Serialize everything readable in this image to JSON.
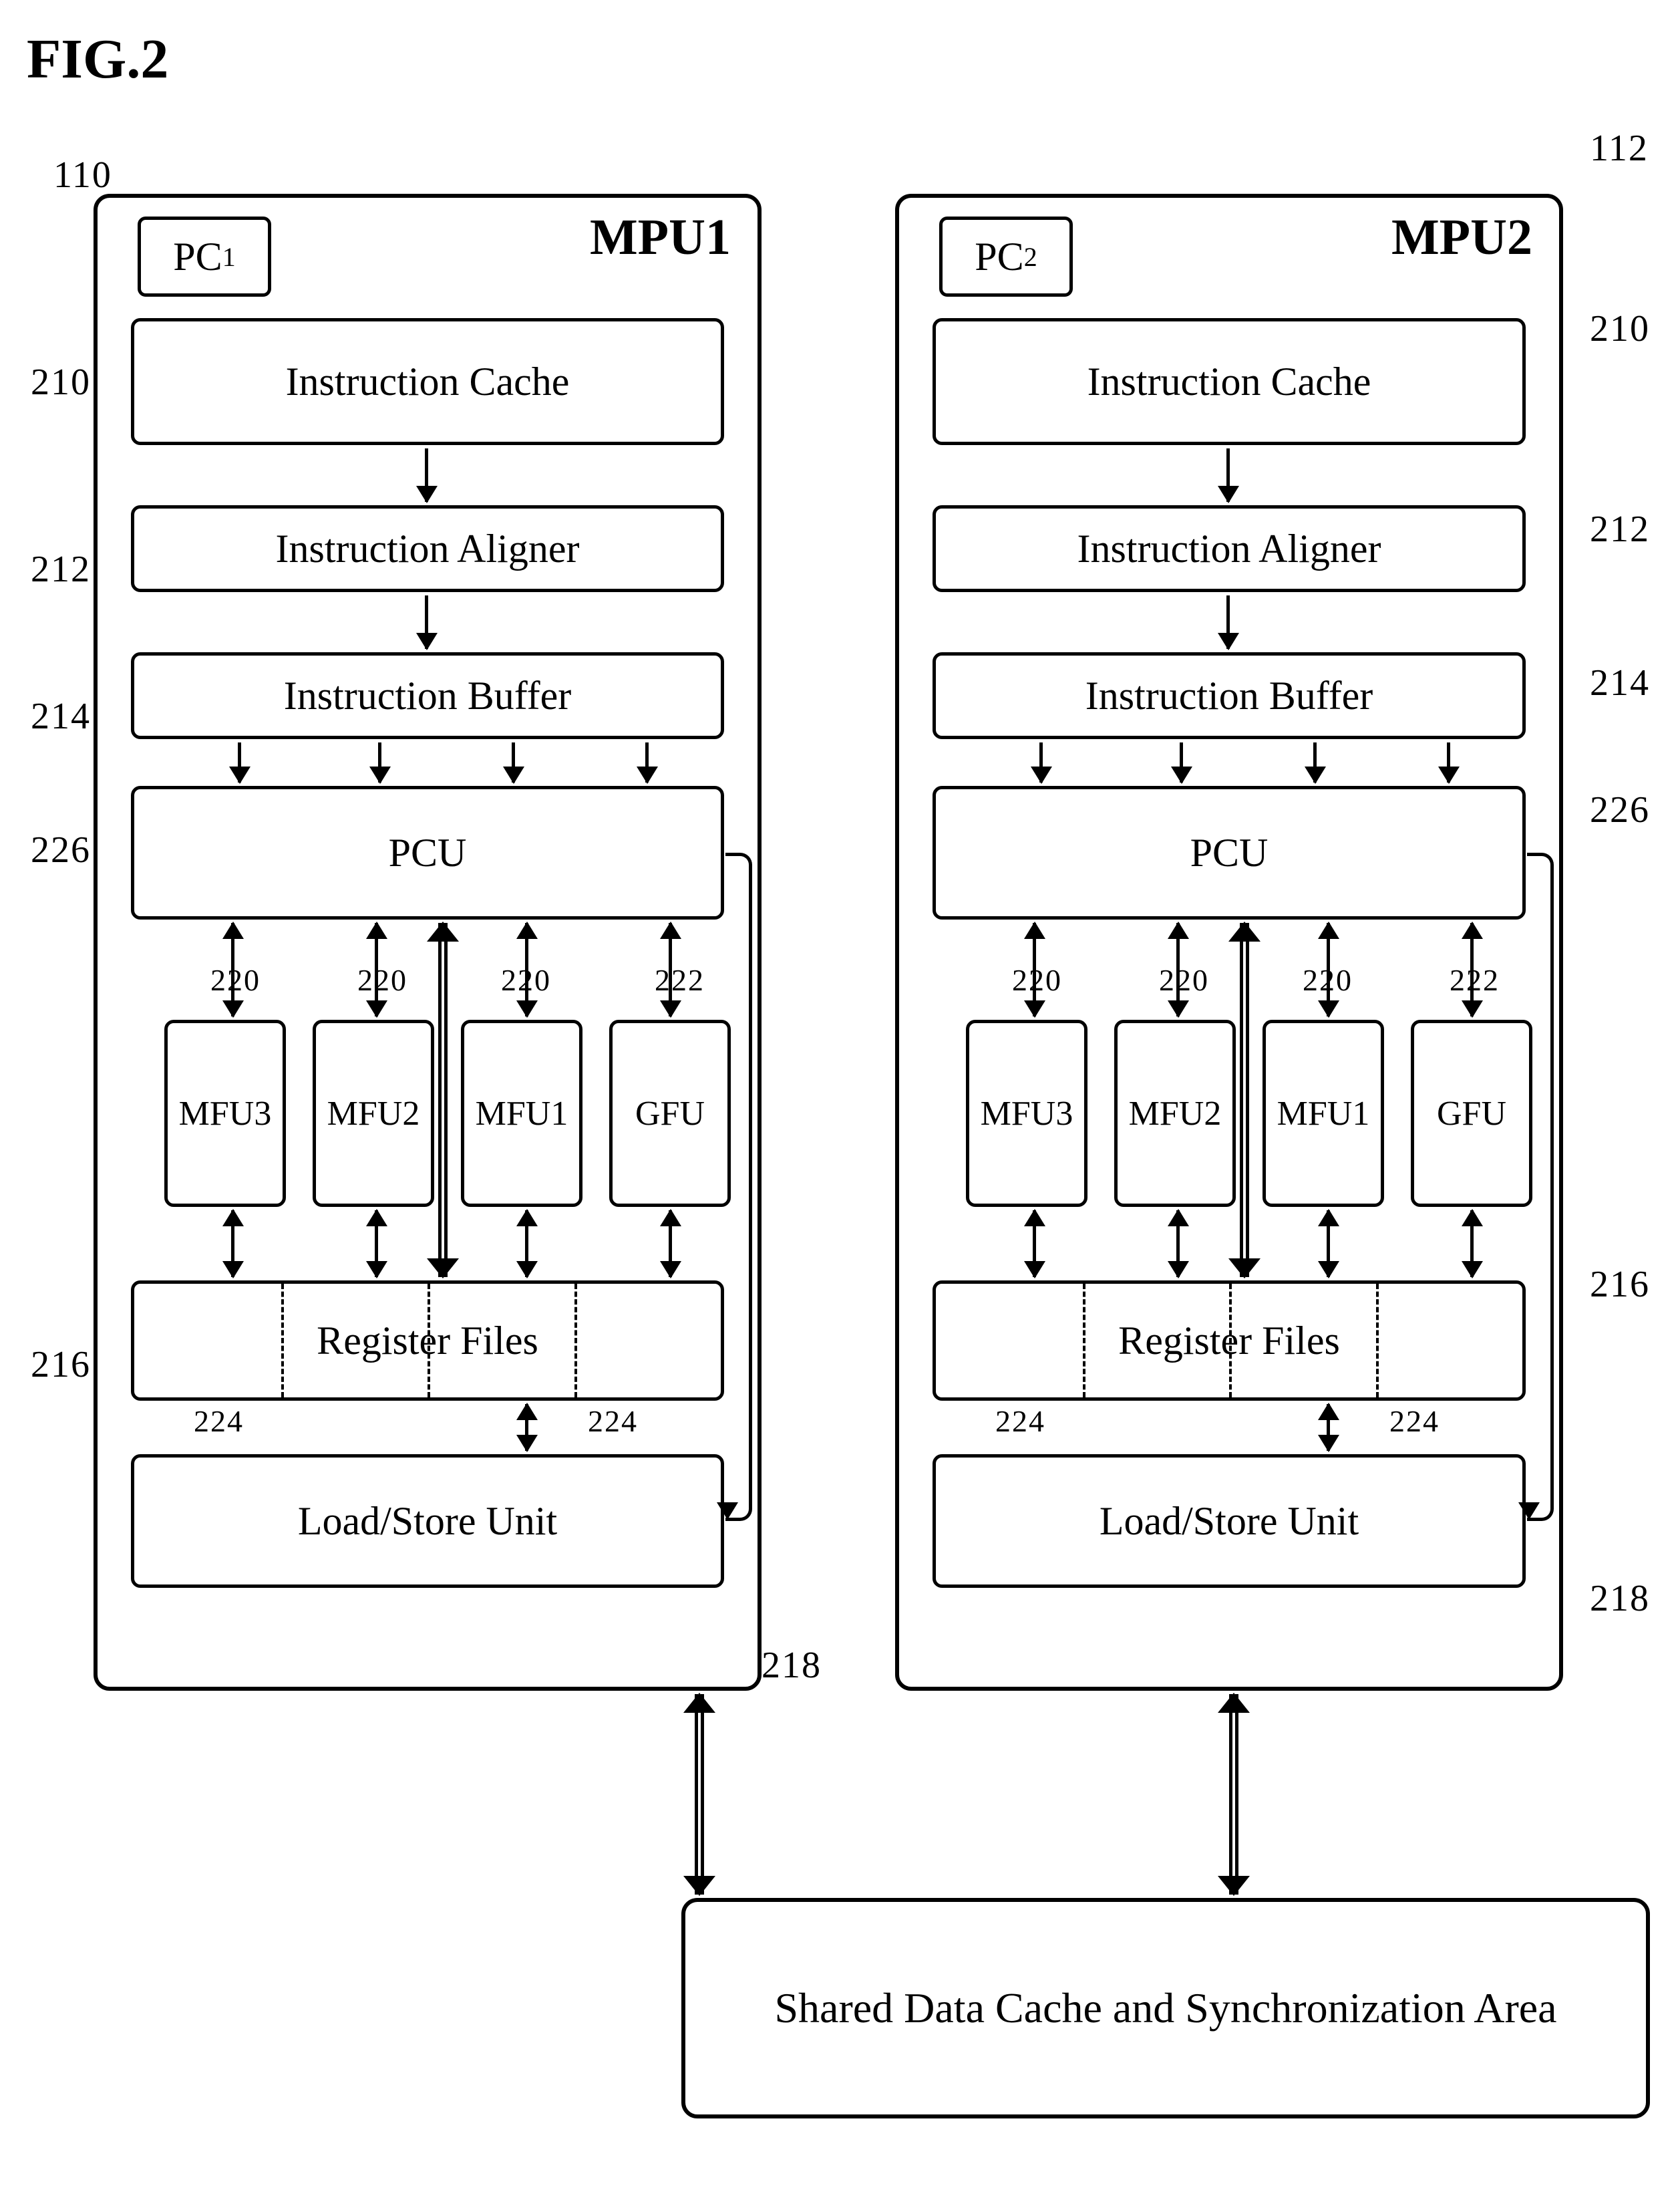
{
  "figure_label": "FIG.2",
  "mpu": [
    {
      "title": "MPU1",
      "pc": "PC",
      "pc_sub": "1"
    },
    {
      "title": "MPU2",
      "pc": "PC",
      "pc_sub": "2"
    }
  ],
  "stages": {
    "ic": "Instruction Cache",
    "ia": "Instruction Aligner",
    "ib": "Instruction Buffer",
    "pcu": "PCU",
    "rf": "Register  Files",
    "ls": "Load/Store Unit"
  },
  "fu": [
    "MFU3",
    "MFU2",
    "MFU1",
    "GFU"
  ],
  "shared": "Shared Data Cache and Synchronization Area",
  "refs": {
    "mpu1": "110",
    "mpu2": "112",
    "ic": "210",
    "ia": "212",
    "ib": "214",
    "pcu": "226",
    "rf": "216",
    "ls": "218",
    "mfu": "220",
    "gfu": "222",
    "rfpart": "224"
  },
  "chart_data": {
    "type": "diagram",
    "title": "FIG.2 – Dual-MPU processor block diagram with shared data cache",
    "blocks": [
      {
        "id": "MPU1",
        "ref": "110",
        "children": [
          {
            "id": "PC1"
          },
          {
            "id": "InstructionCache1",
            "ref": "210"
          },
          {
            "id": "InstructionAligner1",
            "ref": "212"
          },
          {
            "id": "InstructionBuffer1",
            "ref": "214"
          },
          {
            "id": "PCU1",
            "ref": "226"
          },
          {
            "id": "MFU3_1",
            "ref": "220"
          },
          {
            "id": "MFU2_1",
            "ref": "220"
          },
          {
            "id": "MFU1_1",
            "ref": "220"
          },
          {
            "id": "GFU_1",
            "ref": "222"
          },
          {
            "id": "RegisterFiles1",
            "ref": "216",
            "partitions_ref": "224"
          },
          {
            "id": "LoadStore1",
            "ref": "218"
          }
        ]
      },
      {
        "id": "MPU2",
        "ref": "112",
        "children": [
          {
            "id": "PC2"
          },
          {
            "id": "InstructionCache2",
            "ref": "210"
          },
          {
            "id": "InstructionAligner2",
            "ref": "212"
          },
          {
            "id": "InstructionBuffer2",
            "ref": "214"
          },
          {
            "id": "PCU2",
            "ref": "226"
          },
          {
            "id": "MFU3_2",
            "ref": "220"
          },
          {
            "id": "MFU2_2",
            "ref": "220"
          },
          {
            "id": "MFU1_2",
            "ref": "220"
          },
          {
            "id": "GFU_2",
            "ref": "222"
          },
          {
            "id": "RegisterFiles2",
            "ref": "216",
            "partitions_ref": "224"
          },
          {
            "id": "LoadStore2",
            "ref": "218"
          }
        ]
      },
      {
        "id": "SharedDataCache",
        "label": "Shared Data Cache and Synchronization Area"
      }
    ],
    "connections": [
      {
        "from": "InstructionCache",
        "to": "InstructionAligner",
        "dir": "down",
        "per_mpu": true
      },
      {
        "from": "InstructionAligner",
        "to": "InstructionBuffer",
        "dir": "down",
        "per_mpu": true
      },
      {
        "from": "InstructionBuffer",
        "to": "PCU",
        "dir": "down",
        "count": 4,
        "per_mpu": true
      },
      {
        "from": "PCU",
        "to": [
          "MFU3",
          "MFU2",
          "MFU1",
          "GFU"
        ],
        "dir": "bi",
        "per_mpu": true
      },
      {
        "from": "PCU",
        "to": "RegisterFiles",
        "dir": "bi",
        "double_line": true,
        "per_mpu": true
      },
      {
        "from": [
          "MFU3",
          "MFU2",
          "MFU1",
          "GFU"
        ],
        "to": "RegisterFiles",
        "dir": "bi",
        "per_mpu": true
      },
      {
        "from": "RegisterFiles",
        "to": "LoadStoreUnit",
        "dir": "bi",
        "per_mpu": true
      },
      {
        "from": "PCU",
        "to": "LoadStoreUnit",
        "dir": "uni_right_side_loop",
        "per_mpu": true
      },
      {
        "from": "LoadStore1",
        "to": "SharedDataCache",
        "dir": "bi"
      },
      {
        "from": "LoadStore2",
        "to": "SharedDataCache",
        "dir": "bi"
      }
    ]
  }
}
